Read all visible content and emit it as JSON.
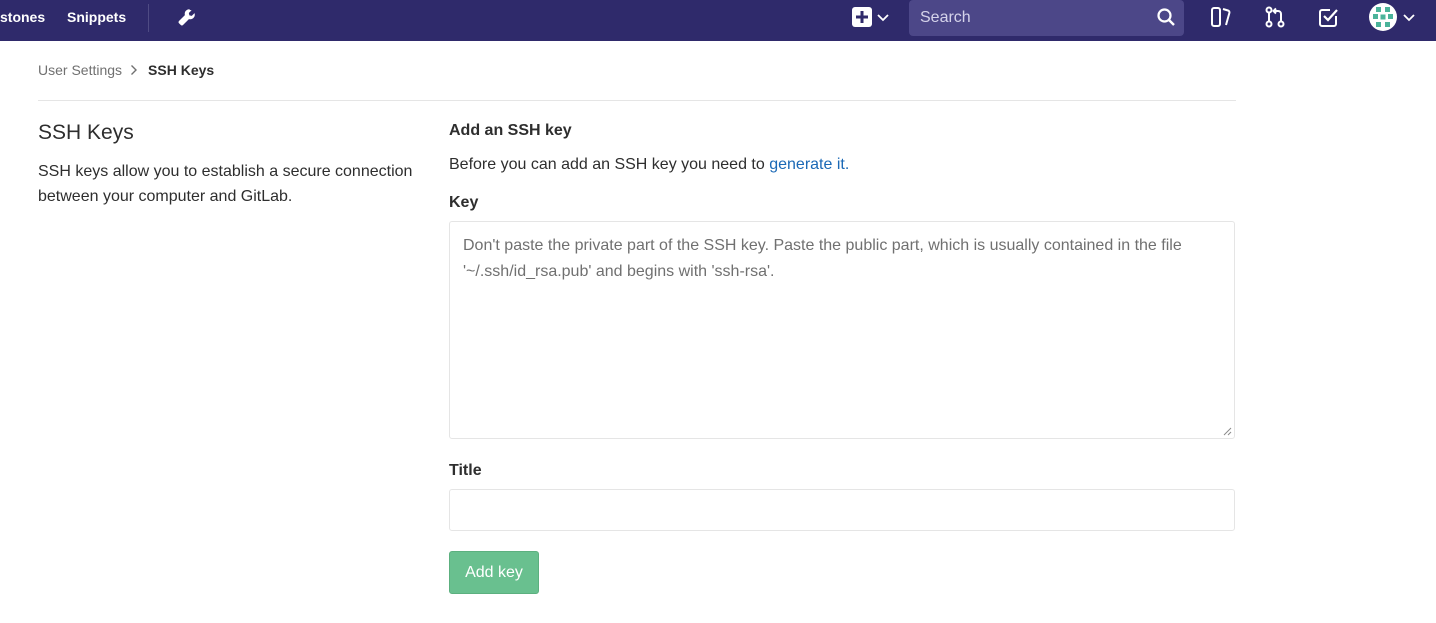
{
  "navbar": {
    "milestones_label": "stones",
    "snippets_label": "Snippets",
    "search_placeholder": "Search",
    "background": "#2f2a6b",
    "icons": [
      "wrench-icon",
      "plus-square-icon",
      "chevron-down-icon",
      "search-icon",
      "issues-icon",
      "merge-request-icon",
      "todo-icon",
      "avatar",
      "chevron-down-icon"
    ]
  },
  "breadcrumb": {
    "parent": "User Settings",
    "current": "SSH Keys"
  },
  "sidebar": {
    "title": "SSH Keys",
    "description": "SSH keys allow you to establish a secure connection between your computer and GitLab."
  },
  "form": {
    "heading": "Add an SSH key",
    "intro_text": "Before you can add an SSH key you need to ",
    "intro_link": "generate it.",
    "key_label": "Key",
    "key_placeholder": "Don't paste the private part of the SSH key. Paste the public part, which is usually contained in the file '~/.ssh/id_rsa.pub' and begins with 'ssh-rsa'.",
    "key_value": "",
    "title_label": "Title",
    "title_value": "",
    "submit_label": "Add key",
    "submit_color": "#69c08f",
    "link_color": "#1b69b6"
  }
}
